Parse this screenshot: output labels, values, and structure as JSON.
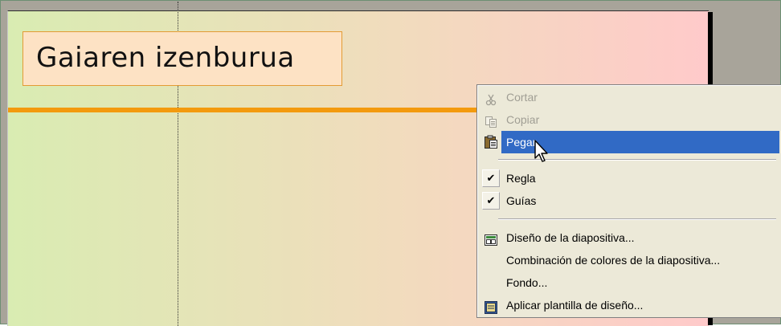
{
  "slide": {
    "title": "Gaiaren izenburua"
  },
  "context_menu": {
    "items": [
      {
        "label": "Cortar",
        "icon": "scissors-icon",
        "enabled": false
      },
      {
        "label": "Copiar",
        "icon": "copy-icon",
        "enabled": false
      },
      {
        "label": "Pegar",
        "icon": "clipboard-paste-icon",
        "enabled": true,
        "highlighted": true
      },
      {
        "label": "Regla",
        "icon": "checkmark-icon",
        "checked": true
      },
      {
        "label": "Guías",
        "icon": "checkmark-icon",
        "checked": true
      },
      {
        "label": "Diseño de la diapositiva...",
        "icon": "slide-layout-icon"
      },
      {
        "label": "Combinación de colores de la diapositiva...",
        "icon": ""
      },
      {
        "label": "Fondo...",
        "icon": ""
      },
      {
        "label": "Aplicar plantilla de diseño...",
        "icon": "design-template-icon"
      }
    ]
  },
  "colors": {
    "highlight": "#316ac5",
    "menu_bg": "#ece9d8",
    "title_box_bg": "#fde2c4",
    "accent_line": "#f39a0e"
  }
}
